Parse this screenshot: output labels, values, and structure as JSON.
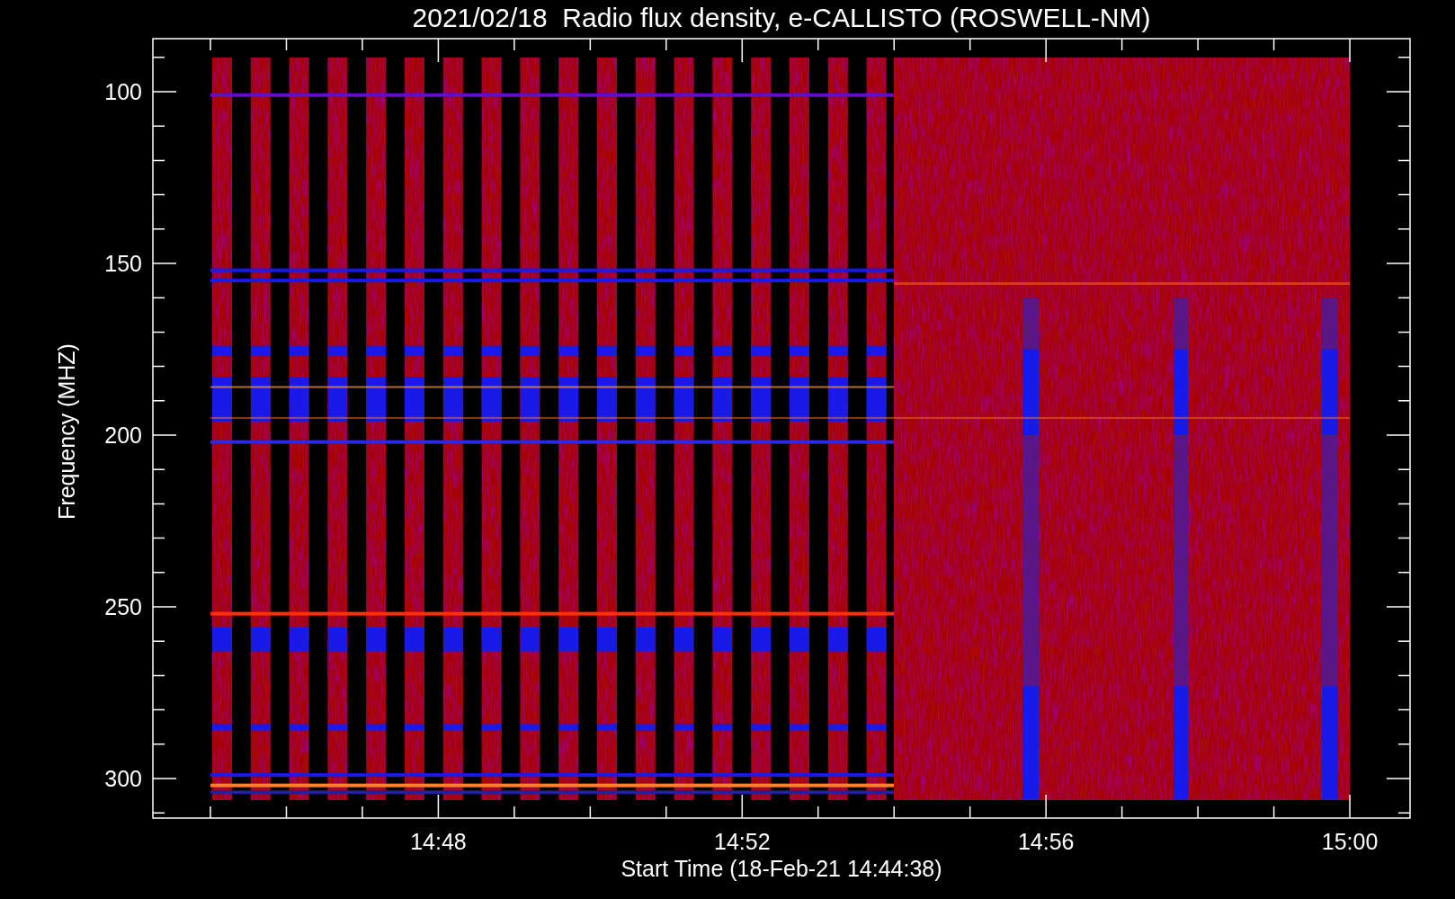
{
  "title": "2021/02/18  Radio flux density, e-CALLISTO (ROSWELL-NM)",
  "y_axis": {
    "label": "Frequency (MHZ)",
    "tick_labels": [
      "100",
      "150",
      "200",
      "250",
      "300"
    ]
  },
  "x_axis": {
    "label": "Start Time (18-Feb-21 14:44:38)",
    "tick_labels": [
      "14:48",
      "14:52",
      "14:56",
      "15:00"
    ]
  }
}
